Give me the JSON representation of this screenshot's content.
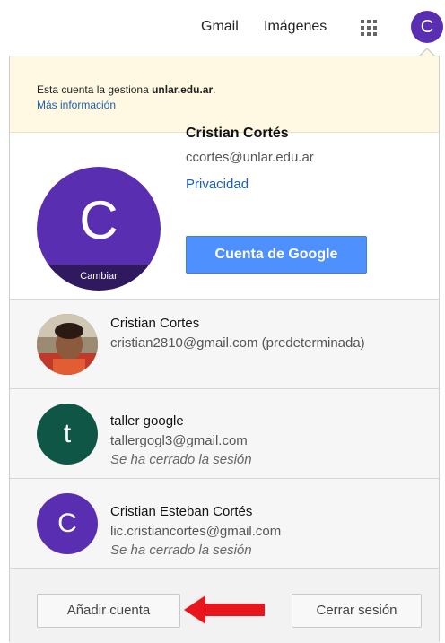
{
  "topbar": {
    "gmail": "Gmail",
    "images": "Imágenes",
    "avatar_letter": "C"
  },
  "notice": {
    "text_prefix": "Esta cuenta la gestiona ",
    "domain": "unlar.edu.ar",
    "text_suffix": ".",
    "more_info": "Más información"
  },
  "profile": {
    "avatar_letter": "C",
    "change_label": "Cambiar",
    "name": "Cristian Cortés",
    "email": "ccortes@unlar.edu.ar",
    "privacy": "Privacidad",
    "google_account_button": "Cuenta de Google"
  },
  "accounts": [
    {
      "name": "Cristian Cortes",
      "email": "cristian2810@gmail.com (predeterminada)",
      "status": ""
    },
    {
      "avatar_letter": "t",
      "name": "taller google",
      "email": "tallergogl3@gmail.com",
      "status": "Se ha cerrado la sesión"
    },
    {
      "avatar_letter": "C",
      "name": "Cristian Esteban Cortés",
      "email": "lic.cristiancortes@gmail.com",
      "status": "Se ha cerrado la sesión"
    }
  ],
  "footer": {
    "add_account": "Añadir cuenta",
    "sign_out": "Cerrar sesión"
  },
  "colors": {
    "accent_purple": "#5a2eb0",
    "google_blue": "#4d90fe",
    "dark_green": "#0f5647",
    "notice_bg": "#fff9e3",
    "arrow_red": "#e8161c"
  },
  "icons": [
    "apps-grid-icon",
    "profile-photo-icon",
    "red-arrow-icon"
  ]
}
